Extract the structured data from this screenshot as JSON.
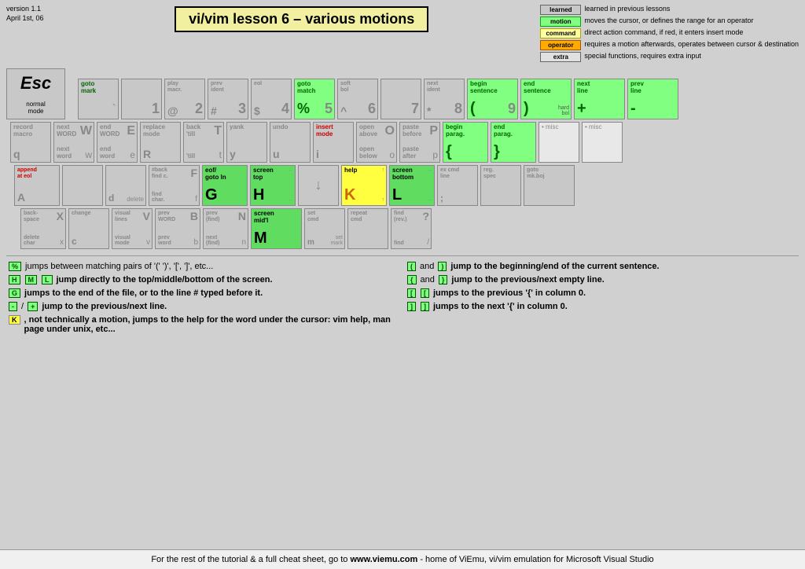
{
  "header": {
    "version": "version 1.1",
    "date": "April 1st, 06",
    "title": "vi/vim lesson 6 – various motions"
  },
  "legend": {
    "items": [
      {
        "badge": "learned",
        "class": "badge-learned",
        "text": "learned in previous lessons"
      },
      {
        "badge": "motion",
        "class": "badge-motion",
        "text": "moves the cursor, or defines the range for an operator"
      },
      {
        "badge": "command",
        "class": "badge-command",
        "text": "direct action command, if red, it enters insert mode"
      },
      {
        "badge": "operator",
        "class": "badge-operator",
        "text": "requires a motion afterwards, operates between cursor & destination"
      },
      {
        "badge": "extra",
        "class": "badge-extra",
        "text": "special functions, requires extra input"
      }
    ]
  },
  "footer": {
    "text": "For the rest of the tutorial & a full cheat sheet, go to ",
    "link": "www.viemu.com",
    "suffix": " - home of ViEmu, vi/vim emulation for Microsoft Visual Studio"
  }
}
